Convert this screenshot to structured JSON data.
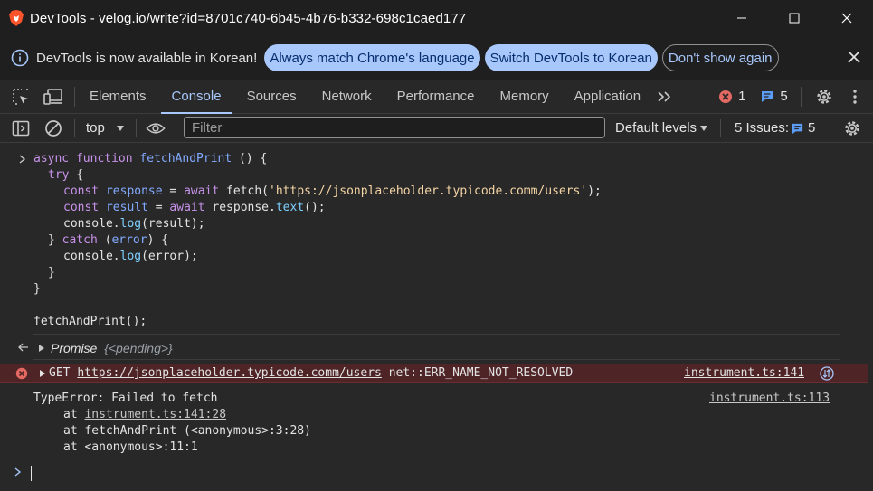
{
  "window": {
    "title": "DevTools - velog.io/write?id=8701c740-6b45-4b76-b332-698c1caed177"
  },
  "infobar": {
    "message": "DevTools is now available in Korean!",
    "btn_match": "Always match Chrome's language",
    "btn_switch": "Switch DevTools to Korean",
    "btn_dont_show": "Don't show again"
  },
  "tabs": {
    "items": [
      "Elements",
      "Console",
      "Sources",
      "Network",
      "Performance",
      "Memory",
      "Application"
    ],
    "active": "Console",
    "error_count": "1",
    "issue_count": "5"
  },
  "toolbar": {
    "context": "top",
    "filter_placeholder": "Filter",
    "levels": "Default levels",
    "issues_label": "5 Issues:",
    "issues_count": "5"
  },
  "console": {
    "code": {
      "l1_kw1": "async",
      "l1_kw2": "function",
      "l1_fn": "fetchAndPrint",
      "l1_rest": " () {",
      "l2_kw": "try",
      "l2_rest": " {",
      "l3_kw": "const",
      "l3_var": "response",
      "l3_eq": " = ",
      "l3_await": "await",
      "l3_call": " fetch(",
      "l3_str": "'https://jsonplaceholder.typicode.comm/users'",
      "l3_end": ");",
      "l4_kw": "const",
      "l4_var": "result",
      "l4_eq": " = ",
      "l4_await": "await",
      "l4_obj": " response.",
      "l4_method": "text",
      "l4_end": "();",
      "l5_obj": "console.",
      "l5_method": "log",
      "l5_end": "(result);",
      "l6_open": "} ",
      "l6_kw": "catch",
      "l6_rest": " (",
      "l6_var": "error",
      "l6_end": ") {",
      "l7_obj": "console.",
      "l7_method": "log",
      "l7_end": "(error);",
      "l8": "}",
      "l9": "}",
      "l10": "fetchAndPrint();"
    },
    "promise": {
      "label": "Promise",
      "value": "{<pending>}"
    },
    "error": {
      "method": "GET",
      "url": "https://jsonplaceholder.typicode.comm/users",
      "message": "net::ERR_NAME_NOT_RESOLVED",
      "source": "instrument.ts:141"
    },
    "typeerror": {
      "message": "TypeError: Failed to fetch",
      "source": "instrument.ts:113",
      "stack1_at": "at ",
      "stack1_link": "instrument.ts:141:28",
      "stack2": "at fetchAndPrint (<anonymous>:3:28)",
      "stack3": "at <anonymous>:11:1"
    }
  },
  "colors": {
    "error_bg": "#4e2426",
    "accent": "#a8c7fa"
  }
}
